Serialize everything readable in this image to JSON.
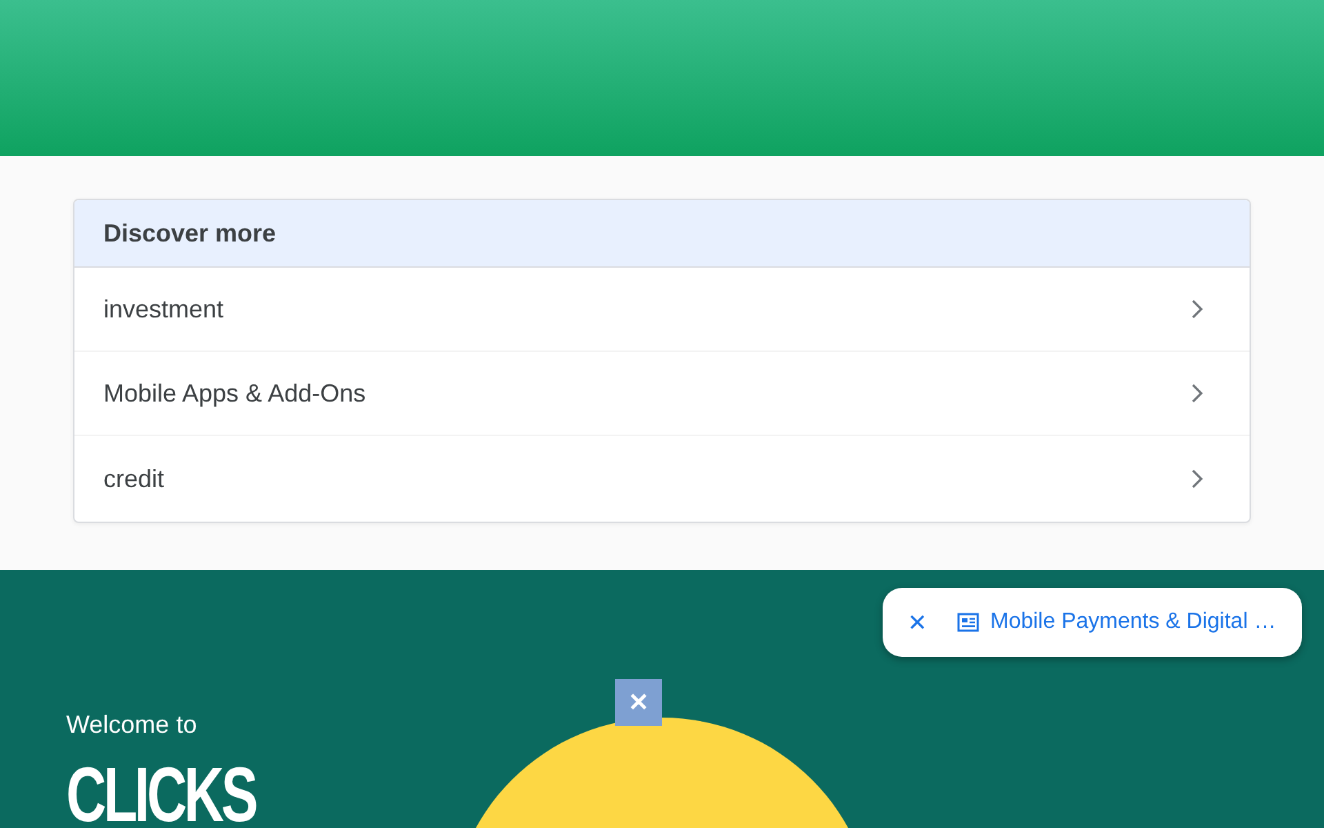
{
  "discover_more": {
    "title": "Discover more",
    "items": [
      {
        "label": "investment"
      },
      {
        "label": "Mobile Apps & Add-Ons"
      },
      {
        "label": "credit"
      }
    ]
  },
  "floating_chip": {
    "close": "✕",
    "label": "Mobile Payments & Digital …"
  },
  "ad_close": "✕",
  "hero": {
    "greeting": "Welcome to",
    "brand": "CLICKS"
  }
}
